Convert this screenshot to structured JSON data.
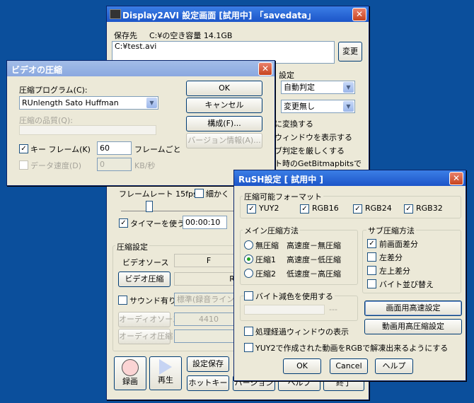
{
  "main_window": {
    "title": "Display2AVI 設定画面 [試用中] 「savedata」",
    "save_dest_label": "保存先",
    "free_space": "C:¥の空き容量 14.1GB",
    "path": "C:¥test.avi",
    "change_button": "変更",
    "partial_setting": "設定",
    "auto_select": "自動判定",
    "nochange_select": "変更無し",
    "partial_opt1": "に変換する",
    "partial_opt2": "ウィンドウを表示する",
    "partial_opt3": "ブ判定を厳しくする",
    "partial_opt4": "ト時のGetBitmapbitsで",
    "framerate_label": "フレームレート 15fps",
    "fine_label": "細かく",
    "timer_label": "タイマーを使う",
    "timer_value": "00:00:10",
    "compression_settings": "圧縮設定",
    "video_source_label": "ビデオソース",
    "video_source_value": "F",
    "video_compress_button": "ビデオ圧縮",
    "video_compress_value": "RU",
    "sound_label": "サウンド有り",
    "sound_select": "標準(録音ライン",
    "audio_source_button": "オーディオソース",
    "audio_source_value": "4410",
    "audio_compress_button": "オーディオ圧縮",
    "record_label": "録画",
    "play_label": "再生",
    "save_settings_button": "設定保存",
    "hotkey_button": "ホットキー",
    "version_button": "バージョン",
    "help_button": "ヘルプ",
    "exit_button": "終了"
  },
  "video_dialog": {
    "title": "ビデオの圧縮",
    "program_label": "圧縮プログラム(C):",
    "program_value": "RUnlength Sato Huffman",
    "quality_label": "圧縮の品質(Q):",
    "keyframe_label": "キー フレーム(K)",
    "keyframe_value": "60",
    "keyframe_unit": "フレームごと",
    "datarate_label": "データ速度(D)",
    "datarate_value": "0",
    "datarate_unit": "KB/秒",
    "ok": "OK",
    "cancel": "キャンセル",
    "configure": "構成(F)...",
    "version_info": "バージョン情報(A)..."
  },
  "rush_dialog": {
    "title": "RuSH設定 [ 試用中 ]",
    "formats_group": "圧縮可能フォーマット",
    "formats": [
      "YUY2",
      "RGB16",
      "RGB24",
      "RGB32"
    ],
    "main_group": "メイン圧縮方法",
    "main_options": [
      {
        "name": "無圧縮",
        "desc": "高速度－無圧縮"
      },
      {
        "name": "圧縮1",
        "desc": "高速度－低圧縮"
      },
      {
        "name": "圧縮2",
        "desc": "低速度－高圧縮"
      }
    ],
    "sub_group": "サブ圧縮方法",
    "sub_options": [
      "前画面差分",
      "左差分",
      "左上差分",
      "バイト並び替え"
    ],
    "byte_reduce_label": "バイト減色を使用する",
    "byte_reduce_value": "---",
    "screen_fast_button": "画面用高速設定",
    "video_high_button": "動画用高圧縮設定",
    "progress_window_label": "処理経過ウィンドウの表示",
    "yuy2_rgb_label": "YUY2で作成された動画をRGBで解凍出来るようにする",
    "ok": "OK",
    "cancel": "Cancel",
    "help": "ヘルプ"
  }
}
